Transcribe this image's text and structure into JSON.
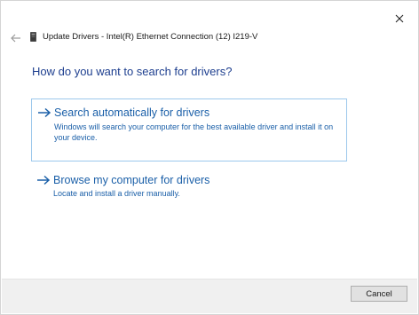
{
  "window": {
    "close_icon": "close-icon",
    "back_icon": "back-arrow-icon"
  },
  "header": {
    "device_icon": "network-adapter-icon",
    "title": "Update Drivers - Intel(R) Ethernet Connection (12) I219-V"
  },
  "main": {
    "heading": "How do you want to search for drivers?",
    "options": [
      {
        "icon": "arrow-right-icon",
        "title": "Search automatically for drivers",
        "description": "Windows will search your computer for the best available driver and install it on your device."
      },
      {
        "icon": "arrow-right-icon",
        "title": "Browse my computer for drivers",
        "description": "Locate and install a driver manually."
      }
    ]
  },
  "footer": {
    "cancel_label": "Cancel"
  },
  "colors": {
    "heading": "#1e3f8f",
    "link": "#1a5fa8",
    "option_border": "#9cc8ec",
    "footer_bg": "#f0f0f0"
  }
}
